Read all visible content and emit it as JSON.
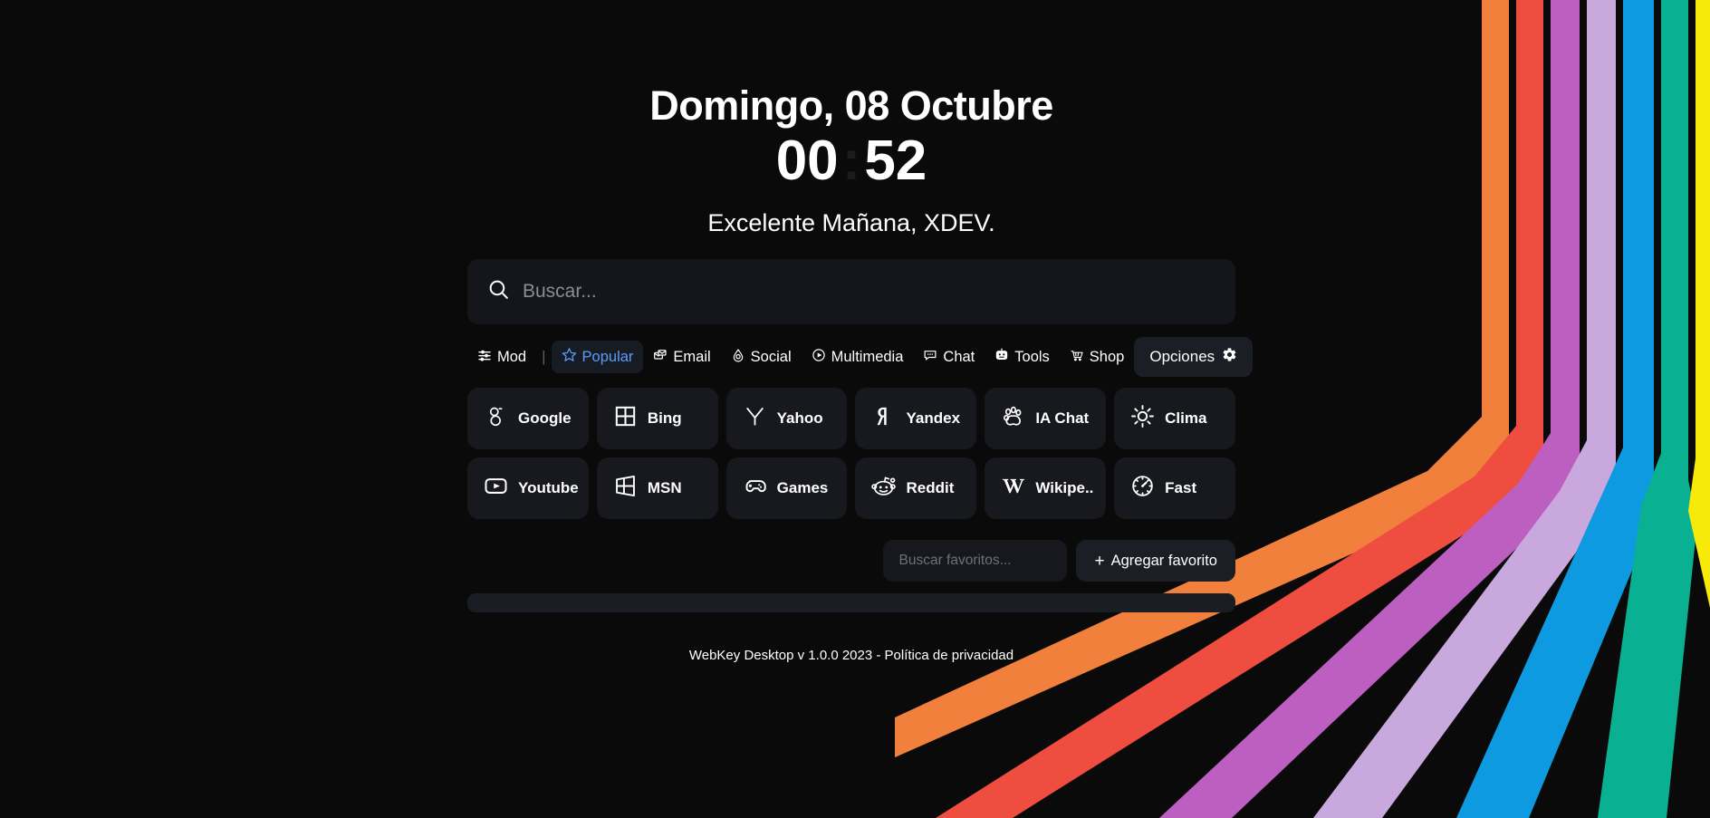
{
  "app": {
    "background_color": "#0a0a0a",
    "accent_color": "#5b9cf8",
    "panel_color": "#17191f"
  },
  "clock": {
    "date": "Domingo, 08 Octubre",
    "hours": "00",
    "separator": ":",
    "minutes": "52"
  },
  "greeting": {
    "text": "Excelente Mañana, XDEV."
  },
  "search": {
    "placeholder": "Buscar...",
    "value": "",
    "icon": "search-icon"
  },
  "categories": {
    "items": [
      {
        "label": "Mod",
        "icon": "sliders-icon",
        "active": false
      },
      {
        "label": "Popular",
        "icon": "star-icon",
        "active": true
      },
      {
        "label": "Email",
        "icon": "mail-icon",
        "active": false
      },
      {
        "label": "Social",
        "icon": "social-icon",
        "active": false
      },
      {
        "label": "Multimedia",
        "icon": "play-circle-icon",
        "active": false
      },
      {
        "label": "Chat",
        "icon": "chat-bubble-icon",
        "active": false
      },
      {
        "label": "Tools",
        "icon": "robot-icon",
        "active": false
      },
      {
        "label": "Shop",
        "icon": "cart-icon",
        "active": false
      }
    ],
    "divider": "|",
    "options_label": "Opciones",
    "options_icon": "gear-icon"
  },
  "tiles": [
    {
      "label": "Google",
      "icon": "google-icon"
    },
    {
      "label": "Bing",
      "icon": "bing-grid-icon"
    },
    {
      "label": "Yahoo",
      "icon": "yahoo-y-icon"
    },
    {
      "label": "Yandex",
      "icon": "yandex-icon"
    },
    {
      "label": "IA Chat",
      "icon": "paw-icon"
    },
    {
      "label": "Clima",
      "icon": "sun-icon"
    },
    {
      "label": "Youtube",
      "icon": "youtube-play-icon"
    },
    {
      "label": "MSN",
      "icon": "windows-icon"
    },
    {
      "label": "Games",
      "icon": "gamepad-icon"
    },
    {
      "label": "Reddit",
      "icon": "reddit-icon"
    },
    {
      "label": "Wikipe..",
      "icon": "wikipedia-w-icon"
    },
    {
      "label": "Fast",
      "icon": "speedometer-icon"
    }
  ],
  "favorites": {
    "search_placeholder": "Buscar favoritos...",
    "search_value": "",
    "add_plus": "+",
    "add_label": "Agregar favorito"
  },
  "footer": {
    "text": "WebKey Desktop v 1.0.0 2023 - Política de privacidad"
  },
  "decoration": {
    "name": "rainbow-stripes",
    "colors": [
      "#f0803c",
      "#ef4d3f",
      "#bd5fc0",
      "#c9a8dd",
      "#0d9ae0",
      "#09b091",
      "#f7e90a"
    ]
  }
}
